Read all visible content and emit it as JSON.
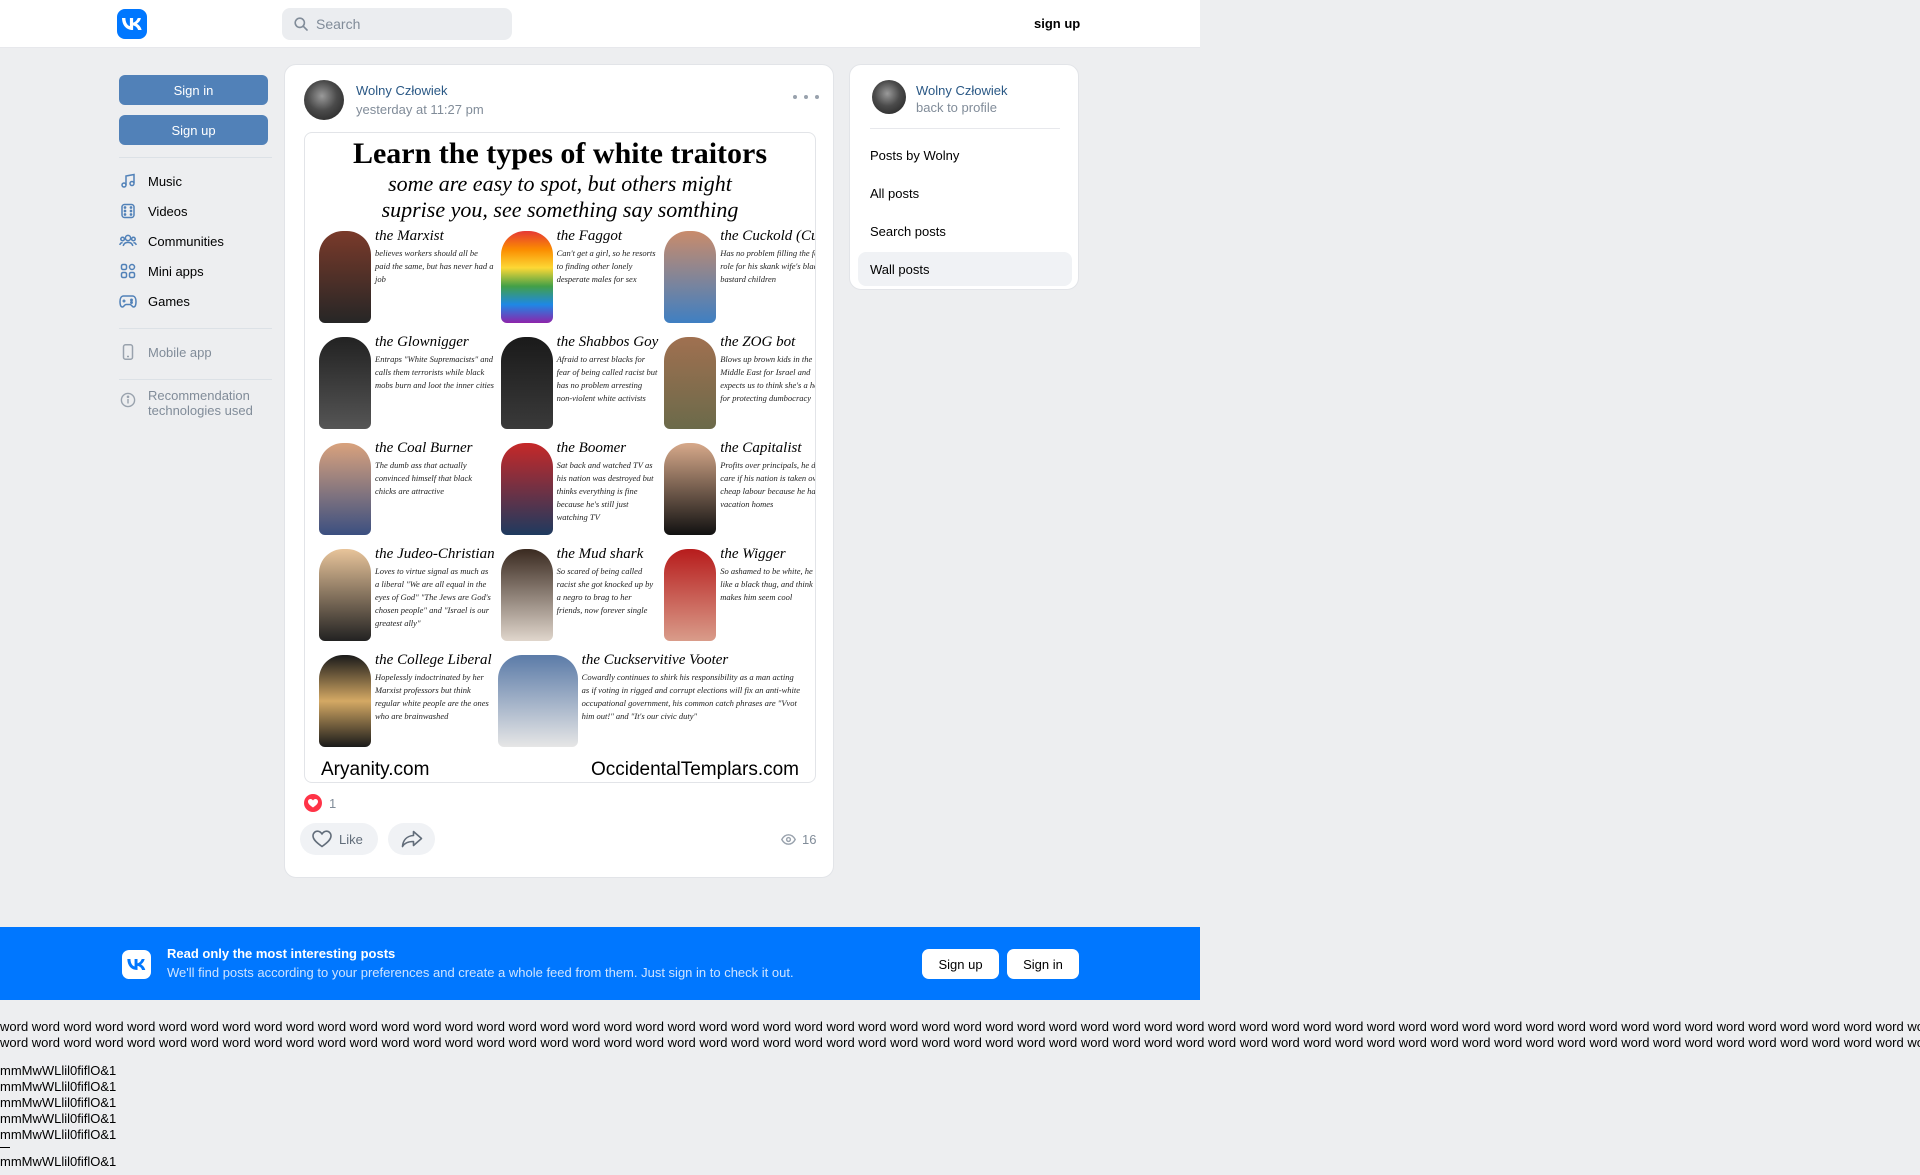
{
  "header": {
    "search_placeholder": "Search",
    "signup_label": "sign up"
  },
  "leftnav": {
    "signin_label": "Sign in",
    "signup_label": "Sign up",
    "items": [
      {
        "label": "Music",
        "icon": "music-icon"
      },
      {
        "label": "Videos",
        "icon": "video-icon"
      },
      {
        "label": "Communities",
        "icon": "users-icon"
      },
      {
        "label": "Mini apps",
        "icon": "apps-icon"
      },
      {
        "label": "Games",
        "icon": "gamepad-icon"
      }
    ],
    "mobile_app_label": "Mobile app",
    "recommendation_label_1": "Recommendation",
    "recommendation_label_2": "technologies used"
  },
  "post": {
    "author": "Wolny Człowiek",
    "time": "yesterday at 11:27 pm",
    "image": {
      "title": "Learn the types of white traitors",
      "subtitle_1": "some are easy to spot, but others might",
      "subtitle_2": "suprise you, see something say somthing",
      "cells": [
        {
          "name": "the Marxist",
          "desc": "believes workers should all be paid the same, but has never had a job"
        },
        {
          "name": "the Faggot",
          "desc": "Can't get a girl, so he resorts to finding other lonely desperate males for sex"
        },
        {
          "name": "the Cuckold (Cuck)",
          "desc": "Has no problem filling the father role for his skank wife's black bastard children"
        },
        {
          "name": "the Glownigger",
          "desc": "Entraps \"White Supremacists\" and calls them terrorists while black mobs burn and loot the inner cities"
        },
        {
          "name": "the Shabbos Goy",
          "desc": "Afraid to arrest blacks for fear of being called racist but has no problem arresting non-violent white activists"
        },
        {
          "name": "the ZOG bot",
          "desc": "Blows up brown kids in the Middle East for Israel and expects us to think she's a hero for protecting dumbocracy"
        },
        {
          "name": "the Coal Burner",
          "desc": "The dumb ass that actually convinced himself that black chicks are attractive"
        },
        {
          "name": "the Boomer",
          "desc": "Sat back and watched TV as his nation was destroyed but thinks everything is fine because he's still just watching TV"
        },
        {
          "name": "the Capitalist",
          "desc": "Profits over principals, he doesn't care if his nation is taken over by cheap labour because he has vacation homes"
        },
        {
          "name": "the Judeo-Christian",
          "desc": "Loves to virtue signal as much as a liberal \"We are all equal in the eyes of God\" \"The Jews are God's chosen people\" and \"Israel is our greatest ally\""
        },
        {
          "name": "the Mud shark",
          "desc": "So scared of being called racist she got knocked up by a negro to brag to her friends, now forever single"
        },
        {
          "name": "the Wigger",
          "desc": "So ashamed to be white, he acts like a black thug, and think this makes him seem cool"
        },
        {
          "name": "the College Liberal",
          "desc": "Hopelessly indoctrinated by her Marxist professors but think regular white people are the ones who are brainwashed"
        },
        {
          "name": "the Cuckservitive Vooter",
          "desc": "Cowardly continues to shirk his responsibility as a man acting as if voting in rigged and corrupt elections will fix an anti-white occupational government, his common catch phrases are \"Vvot him out!\" and \"It's our civic duty\""
        }
      ],
      "footer_left": "Aryanity.com",
      "footer_right": "OccidentalTemplars.com"
    },
    "likes_count": "1",
    "like_label": "Like",
    "views_count": "16"
  },
  "rpanel": {
    "author": "Wolny Człowiek",
    "back_label": "back to profile",
    "menu": [
      {
        "label": "Posts by Wolny",
        "active": false
      },
      {
        "label": "All posts",
        "active": false
      },
      {
        "label": "Search posts",
        "active": false
      },
      {
        "label": "Wall posts",
        "active": true
      }
    ]
  },
  "promo": {
    "title": "Read only the most interesting posts",
    "text": "We'll find posts according to your preferences and create a whole feed from them. Just sign in to check it out.",
    "signup_label": "Sign up",
    "signin_label": "Sign in"
  },
  "testtext": {
    "line1": "word word word word word word word word word word word word word word word word word word word word word word word word word word word word word word word word word word word word word word word word word word word word word word word word word word word word word word word word word word word word word word word word word word word",
    "line2": "word word word word word word word word word word word word word word word word word word word word word word word word word word word word word word word word word word word word word word word word word word word word word word word word word word word word word word word word word word word word word word word word word word word",
    "glyph_line": "mmMwWLlil0fiflO&1"
  },
  "colors": {
    "brand": "#0077ff",
    "button": "#5181b8",
    "link": "#2a5885",
    "muted": "#818c99",
    "like": "#ff3347"
  }
}
